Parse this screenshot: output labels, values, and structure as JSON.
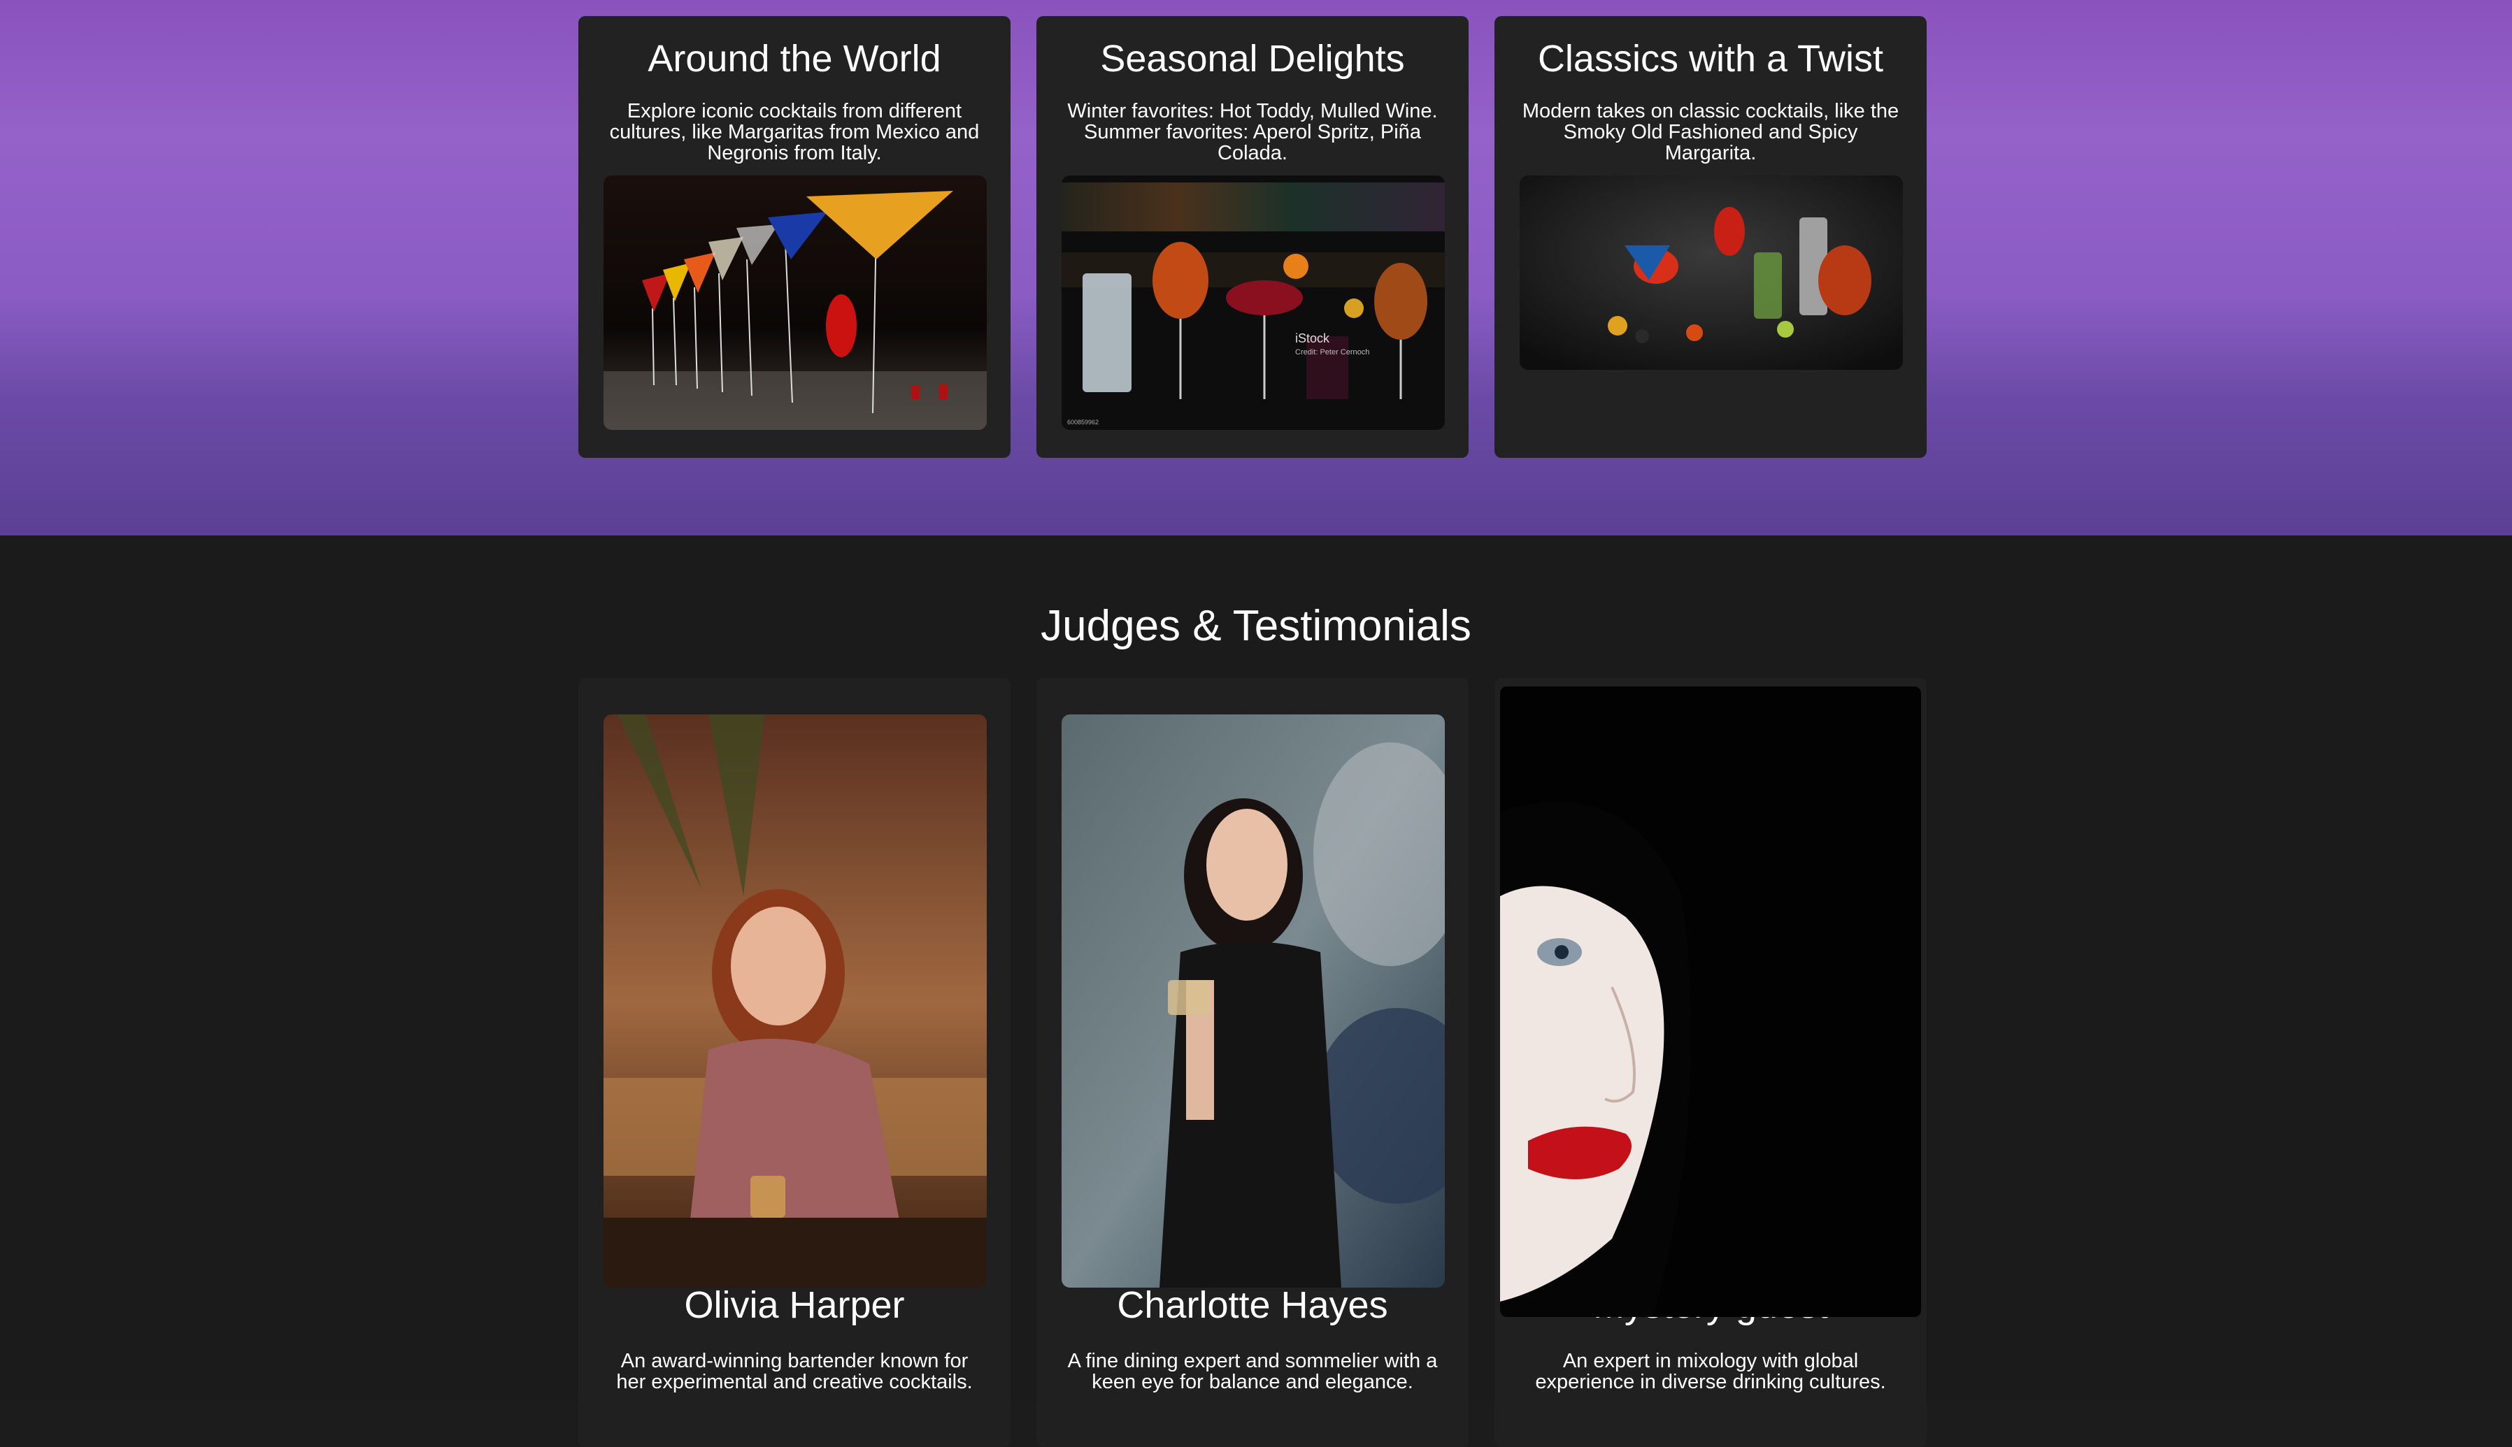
{
  "categories": [
    {
      "title": "Around the World",
      "description": "Explore iconic cocktails from different cultures, like Margaritas from Mexico and Negronis from Italy.",
      "image_icon": "rainbow-martini-glasses-photo"
    },
    {
      "title": "Seasonal Delights",
      "description": "Winter favorites: Hot Toddy, Mulled Wine. Summer favorites: Aperol Spritz, Piña Colada.",
      "image_icon": "seasonal-cocktails-photo",
      "watermark": "iStock",
      "watermark_credit": "Credit: Peter Cernoch",
      "watermark_id": "600859962"
    },
    {
      "title": "Classics with a Twist",
      "description": "Modern takes on classic cocktails, like the Smoky Old Fashioned and Spicy Margarita.",
      "image_icon": "classic-cocktails-photo"
    }
  ],
  "judges_section": {
    "title": "Judges & Testimonials",
    "judges": [
      {
        "name": "Olivia Harper",
        "bio": "An award-winning bartender known for her experimental and creative cocktails.",
        "image_icon": "olivia-portrait-photo"
      },
      {
        "name": "Charlotte Hayes",
        "bio": "A fine dining expert and sommelier with a keen eye for balance and elegance.",
        "image_icon": "charlotte-portrait-photo"
      },
      {
        "name": "Mystery guest",
        "bio": "An expert in mixology with global experience in diverse drinking cultures.",
        "image_icon": "mystery-guest-portrait-photo"
      }
    ]
  },
  "colors": {
    "hero_gradient_top": "#8a52bd",
    "hero_gradient_bottom": "#5b4094",
    "page_background": "#1b1b1b",
    "card_background": "#222222",
    "text": "#ffffff"
  }
}
